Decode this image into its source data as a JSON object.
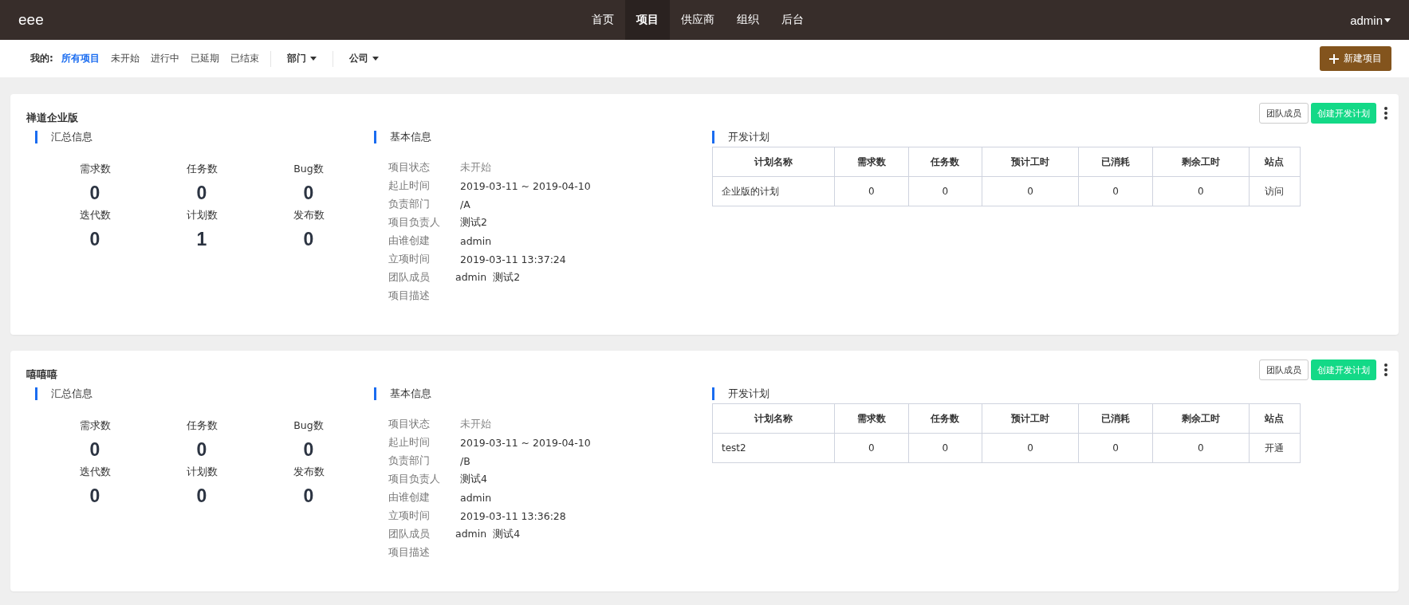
{
  "navbar": {
    "brand": "eee",
    "items": [
      {
        "label": "首页",
        "selected": false
      },
      {
        "label": "项目",
        "selected": true
      },
      {
        "label": "供应商",
        "selected": false
      },
      {
        "label": "组织",
        "selected": false
      },
      {
        "label": "后台",
        "selected": false
      }
    ],
    "user": "admin"
  },
  "filter_bar": {
    "label": "我的:",
    "tabs": [
      {
        "label": "所有项目",
        "selected": true
      },
      {
        "label": "未开始",
        "selected": false
      },
      {
        "label": "进行中",
        "selected": false
      },
      {
        "label": "已延期",
        "selected": false
      },
      {
        "label": "已结束",
        "selected": false
      }
    ],
    "dropdowns": [
      "部门",
      "公司"
    ],
    "new_button": "新建项目"
  },
  "projects": [
    {
      "title": "禅道企业版",
      "team_button": "团队成员",
      "plan_button": "创建开发计划",
      "summary_title": "汇总信息",
      "stats": [
        {
          "label": "需求数",
          "value": "0"
        },
        {
          "label": "任务数",
          "value": "0"
        },
        {
          "label": "Bug数",
          "value": "0"
        },
        {
          "label": "迭代数",
          "value": "0"
        },
        {
          "label": "计划数",
          "value": "1"
        },
        {
          "label": "发布数",
          "value": "0"
        }
      ],
      "basic_title": "基本信息",
      "basic": [
        {
          "label": "项目状态",
          "value": "未开始"
        },
        {
          "label": "起止时间",
          "value": "2019-03-11 ~ 2019-04-10"
        },
        {
          "label": "负责部门",
          "value": "/A"
        },
        {
          "label": "项目负责人",
          "value": "测试2"
        },
        {
          "label": "由谁创建",
          "value": "admin"
        },
        {
          "label": "立项时间",
          "value": "2019-03-11 13:37:24"
        }
      ],
      "members_label": "团队成员",
      "members": [
        "admin",
        "测试2"
      ],
      "desc_label": "项目描述",
      "plan_title": "开发计划",
      "columns": [
        "计划名称",
        "需求数",
        "任务数",
        "预计工时",
        "已消耗",
        "剩余工时",
        "站点"
      ],
      "rows": [
        [
          "企业版的计划",
          "0",
          "0",
          "0",
          "0",
          "0",
          "访问"
        ]
      ]
    },
    {
      "title": "嘻嘻嘻",
      "team_button": "团队成员",
      "plan_button": "创建开发计划",
      "summary_title": "汇总信息",
      "stats": [
        {
          "label": "需求数",
          "value": "0"
        },
        {
          "label": "任务数",
          "value": "0"
        },
        {
          "label": "Bug数",
          "value": "0"
        },
        {
          "label": "迭代数",
          "value": "0"
        },
        {
          "label": "计划数",
          "value": "0"
        },
        {
          "label": "发布数",
          "value": "0"
        }
      ],
      "basic_title": "基本信息",
      "basic": [
        {
          "label": "项目状态",
          "value": "未开始"
        },
        {
          "label": "起止时间",
          "value": "2019-03-11 ~ 2019-04-10"
        },
        {
          "label": "负责部门",
          "value": "/B"
        },
        {
          "label": "项目负责人",
          "value": "测试4"
        },
        {
          "label": "由谁创建",
          "value": "admin"
        },
        {
          "label": "立项时间",
          "value": "2019-03-11 13:36:28"
        }
      ],
      "members_label": "团队成员",
      "members": [
        "admin",
        "测试4"
      ],
      "desc_label": "项目描述",
      "plan_title": "开发计划",
      "columns": [
        "计划名称",
        "需求数",
        "任务数",
        "预计工时",
        "已消耗",
        "剩余工时",
        "站点"
      ],
      "rows": [
        [
          "test2",
          "0",
          "0",
          "0",
          "0",
          "0",
          "开通"
        ]
      ]
    }
  ]
}
